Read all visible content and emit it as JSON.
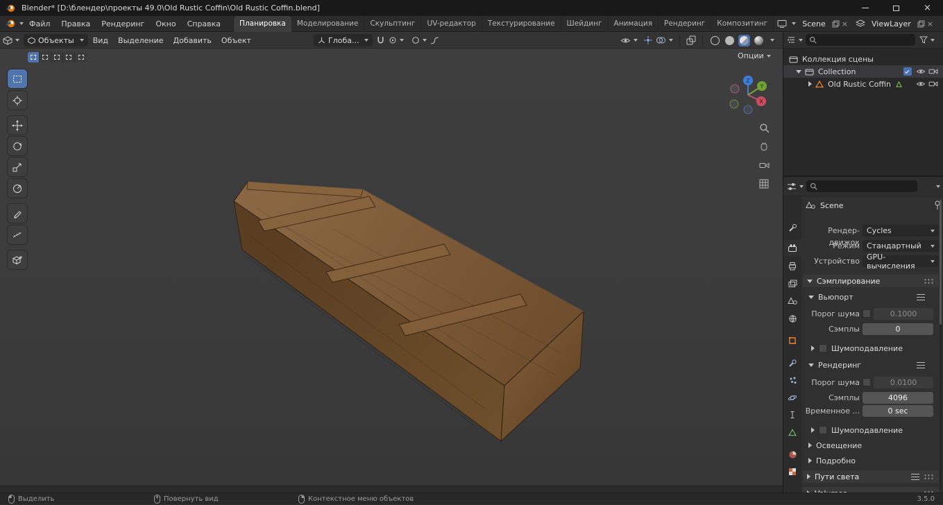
{
  "icons": {
    "close": "×"
  },
  "window": {
    "title": "Blender* [D:\\блендер\\проекты 49.0\\Old Rustic Coffin\\Old Rustic Coffin.blend]"
  },
  "menubar": {
    "menus": [
      "Файл",
      "Правка",
      "Рендеринг",
      "Окно",
      "Справка"
    ],
    "workspaces": [
      "Планировка",
      "Моделирование",
      "Скульптинг",
      "UV-редактор",
      "Текстурирование",
      "Шейдинг",
      "Анимация",
      "Рендеринг",
      "Композитинг"
    ],
    "active_workspace": "Планировка",
    "scene_selector": {
      "value": "Scene"
    },
    "view_layer_selector": {
      "value": "ViewLayer"
    }
  },
  "tool_header": {
    "mode_selector": "Объекты",
    "menus": [
      "Вид",
      "Выделение",
      "Добавить",
      "Объект"
    ],
    "orientation": "Глоба...",
    "options_button": "Опции"
  },
  "viewport": {
    "gizmo_axes": {
      "x": "X",
      "y": "Y",
      "z": "Z"
    }
  },
  "outliner": {
    "rows": [
      {
        "label": "Коллекция сцены"
      },
      {
        "label": "Collection"
      },
      {
        "label": "Old Rustic Coffin"
      }
    ]
  },
  "properties": {
    "breadcrumb": "Scene",
    "rows": {
      "engine_label": "Рендер-движок",
      "engine_value": "Cycles",
      "mode_label": "Режим",
      "mode_value": "Стандартный",
      "device_label": "Устройство",
      "device_value": "GPU-вычисления"
    },
    "sampling": {
      "title": "Сэмплирование",
      "viewport": {
        "title": "Вьюпорт",
        "noise_label": "Порог шума",
        "noise_value": "0.1000",
        "samples_label": "Сэмплы",
        "samples_value": "0",
        "denoise_label": "Шумоподавление"
      },
      "render": {
        "title": "Рендеринг",
        "noise_label": "Порог шума",
        "noise_value": "0.0100",
        "samples_label": "Сэмплы",
        "samples_value": "4096",
        "time_label": "Временное ...",
        "time_value": "0 sec",
        "denoise_label": "Шумоподавление"
      },
      "lights_label": "Освещение",
      "advanced_label": "Подробно"
    },
    "light_paths_label": "Пути света",
    "volumes_label": "Volumes"
  },
  "status_bar": {
    "left": "Выделить",
    "middle": "Повернуть вид",
    "right_action": "Контекстное меню объектов",
    "version": "3.5.0"
  }
}
